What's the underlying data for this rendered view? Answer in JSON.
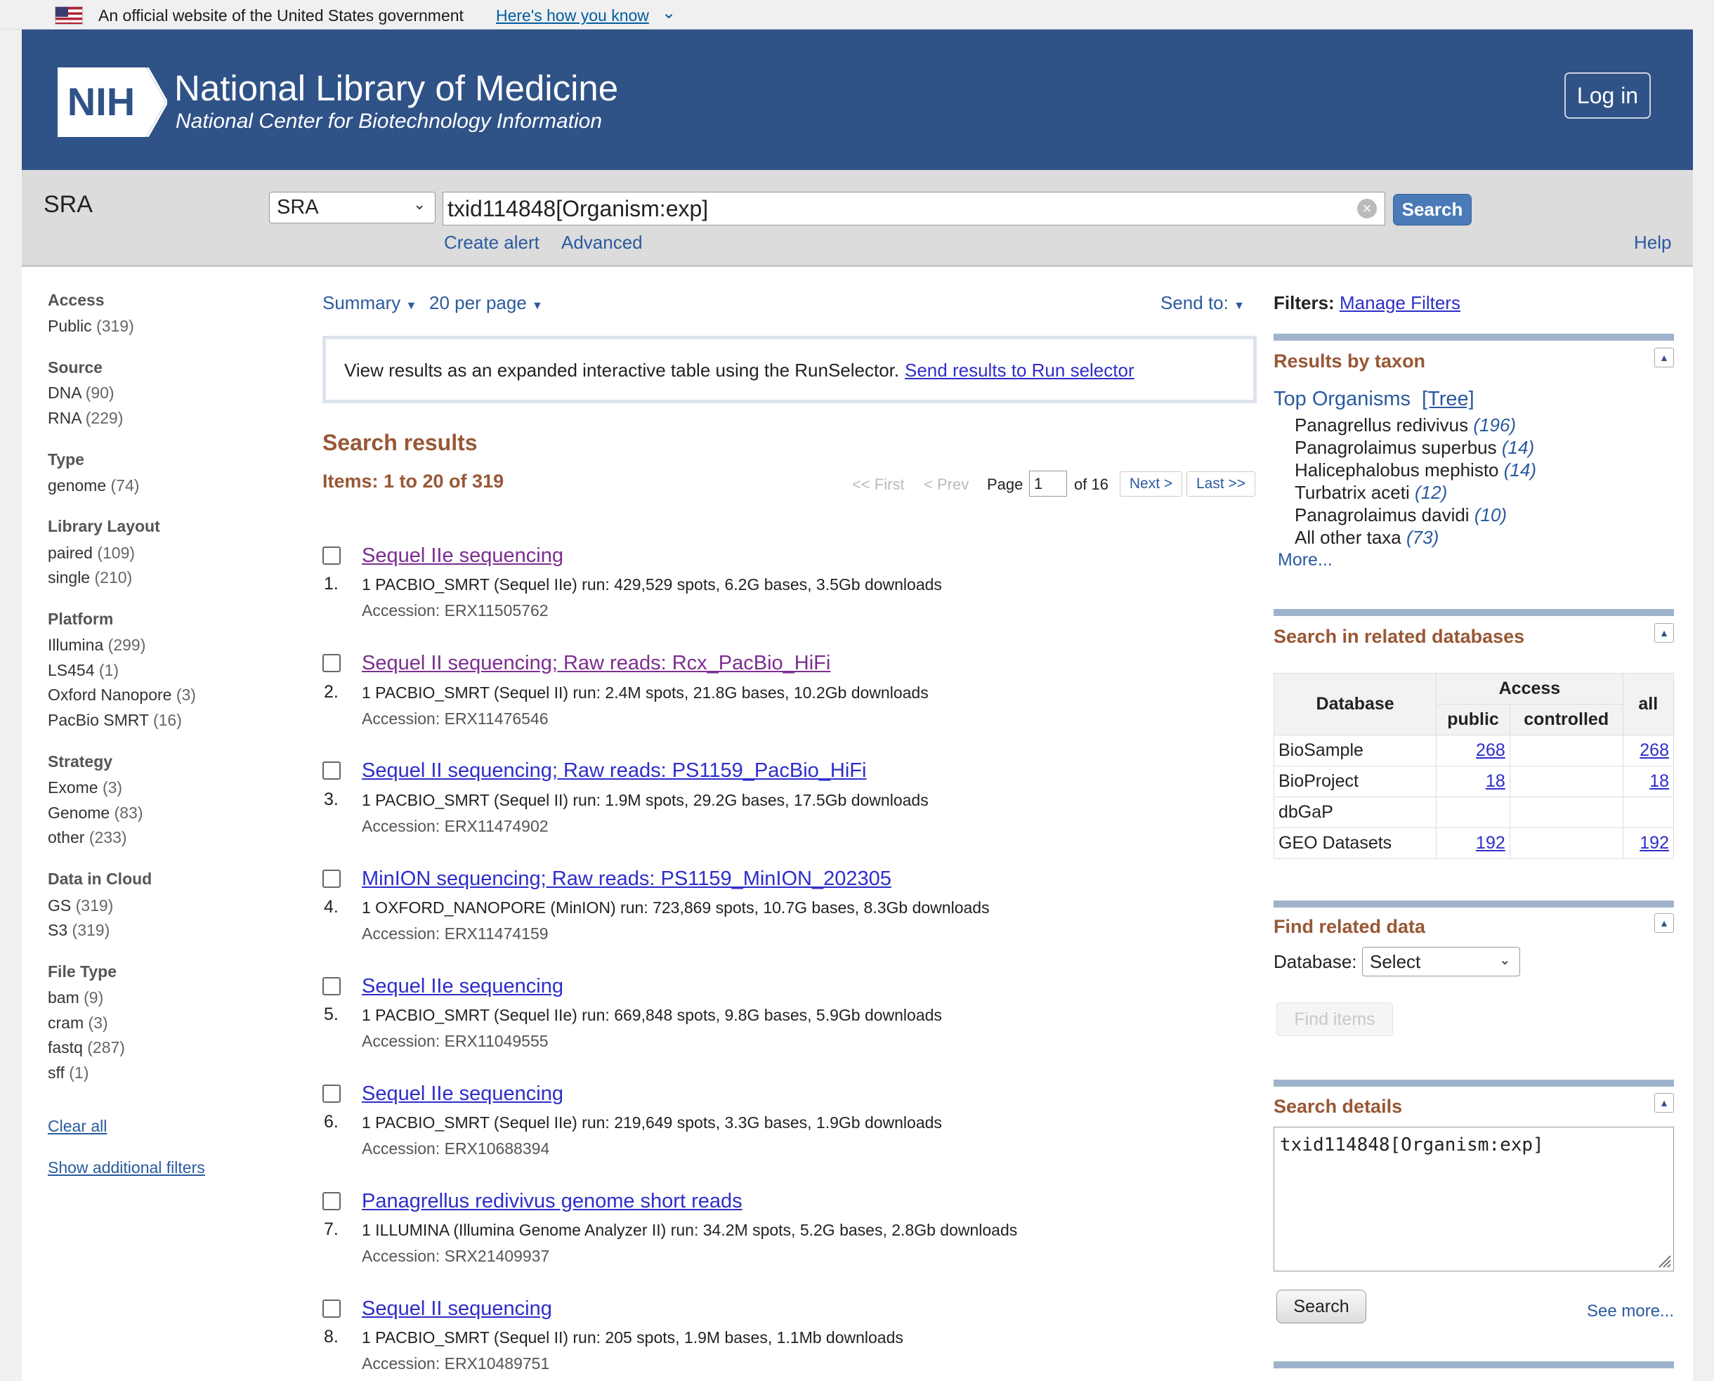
{
  "gov_banner": {
    "text": "An official website of the United States government",
    "link": "Here's how you know"
  },
  "header": {
    "logo_text": "NIH",
    "title": "National Library of Medicine",
    "subtitle": "National Center for Biotechnology Information",
    "login": "Log in"
  },
  "search": {
    "db_name": "SRA",
    "db_select": "SRA",
    "term": "txid114848[Organism:exp]",
    "button": "Search",
    "create_alert": "Create alert",
    "advanced": "Advanced",
    "help": "Help"
  },
  "filters": {
    "groups": [
      {
        "title": "Access",
        "items": [
          {
            "label": "Public",
            "count": "(319)"
          }
        ]
      },
      {
        "title": "Source",
        "items": [
          {
            "label": "DNA",
            "count": "(90)"
          },
          {
            "label": "RNA",
            "count": "(229)"
          }
        ]
      },
      {
        "title": "Type",
        "items": [
          {
            "label": "genome",
            "count": "(74)"
          }
        ]
      },
      {
        "title": "Library Layout",
        "items": [
          {
            "label": "paired",
            "count": "(109)"
          },
          {
            "label": "single",
            "count": "(210)"
          }
        ]
      },
      {
        "title": "Platform",
        "items": [
          {
            "label": "Illumina",
            "count": "(299)"
          },
          {
            "label": "LS454",
            "count": "(1)"
          },
          {
            "label": "Oxford Nanopore",
            "count": "(3)"
          },
          {
            "label": "PacBio SMRT",
            "count": "(16)"
          }
        ]
      },
      {
        "title": "Strategy",
        "items": [
          {
            "label": "Exome",
            "count": "(3)"
          },
          {
            "label": "Genome",
            "count": "(83)"
          },
          {
            "label": "other",
            "count": "(233)"
          }
        ]
      },
      {
        "title": "Data in Cloud",
        "items": [
          {
            "label": "GS",
            "count": "(319)"
          },
          {
            "label": "S3",
            "count": "(319)"
          }
        ]
      },
      {
        "title": "File Type",
        "items": [
          {
            "label": "bam",
            "count": "(9)"
          },
          {
            "label": "cram",
            "count": "(3)"
          },
          {
            "label": "fastq",
            "count": "(287)"
          },
          {
            "label": "sff",
            "count": "(1)"
          }
        ]
      }
    ],
    "clear_all": "Clear all",
    "show_additional": "Show additional filters"
  },
  "controls": {
    "summary": "Summary",
    "per_page": "20 per page",
    "send_to": "Send to:"
  },
  "runselector": {
    "text": "View results as an expanded interactive table using the RunSelector.",
    "link": "Send results to Run selector"
  },
  "results": {
    "title": "Search results",
    "items_count": "Items: 1 to 20 of 319",
    "pager": {
      "first": "<< First",
      "prev": "< Prev",
      "page_label": "Page",
      "page_value": "1",
      "of": "of 16",
      "next": "Next >",
      "last": "Last >>"
    },
    "list": [
      {
        "num": "1.",
        "title": "Sequel IIe sequencing",
        "desc": "1 PACBIO_SMRT (Sequel IIe) run: 429,529 spots, 6.2G bases, 3.5Gb downloads",
        "acc": "Accession: ERX11505762"
      },
      {
        "num": "2.",
        "title": "Sequel II sequencing; Raw reads: Rcx_PacBio_HiFi",
        "desc": "1 PACBIO_SMRT (Sequel II) run: 2.4M spots, 21.8G bases, 10.2Gb downloads",
        "acc": "Accession: ERX11476546"
      },
      {
        "num": "3.",
        "title": "Sequel II sequencing; Raw reads: PS1159_PacBio_HiFi",
        "desc": "1 PACBIO_SMRT (Sequel II) run: 1.9M spots, 29.2G bases, 17.5Gb downloads",
        "acc": "Accession: ERX11474902"
      },
      {
        "num": "4.",
        "title": "MinION sequencing; Raw reads: PS1159_MinION_202305",
        "desc": "1 OXFORD_NANOPORE (MinION) run: 723,869 spots, 10.7G bases, 8.3Gb downloads",
        "acc": "Accession: ERX11474159"
      },
      {
        "num": "5.",
        "title": "Sequel IIe sequencing",
        "desc": "1 PACBIO_SMRT (Sequel IIe) run: 669,848 spots, 9.8G bases, 5.9Gb downloads",
        "acc": "Accession: ERX11049555"
      },
      {
        "num": "6.",
        "title": "Sequel IIe sequencing",
        "desc": "1 PACBIO_SMRT (Sequel IIe) run: 219,649 spots, 3.3G bases, 1.9Gb downloads",
        "acc": "Accession: ERX10688394"
      },
      {
        "num": "7.",
        "title": "Panagrellus redivivus genome short reads",
        "desc": "1 ILLUMINA (Illumina Genome Analyzer II) run: 34.2M spots, 5.2G bases, 2.8Gb downloads",
        "acc": "Accession: SRX21409937"
      },
      {
        "num": "8.",
        "title": "Sequel II sequencing",
        "desc": "1 PACBIO_SMRT (Sequel II) run: 205 spots, 1.9M bases, 1.1Mb downloads",
        "acc": "Accession: ERX10489751"
      }
    ]
  },
  "right": {
    "filters_label": "Filters:",
    "manage_filters": "Manage Filters",
    "taxon": {
      "title": "Results by taxon",
      "top_organisms": "Top Organisms",
      "tree": "[Tree]",
      "organisms": [
        {
          "name": "Panagrellus redivivus",
          "count": "(196)"
        },
        {
          "name": "Panagrolaimus superbus",
          "count": "(14)"
        },
        {
          "name": "Halicephalobus mephisto",
          "count": "(14)"
        },
        {
          "name": "Turbatrix aceti",
          "count": "(12)"
        },
        {
          "name": "Panagrolaimus davidi",
          "count": "(10)"
        },
        {
          "name": "All other taxa",
          "count": "(73)"
        }
      ],
      "more": "More..."
    },
    "related": {
      "title": "Search in related databases",
      "head_database": "Database",
      "head_access": "Access",
      "head_public": "public",
      "head_controlled": "controlled",
      "head_all": "all",
      "rows": [
        {
          "db": "BioSample",
          "public": "268",
          "controlled": "",
          "all": "268"
        },
        {
          "db": "BioProject",
          "public": "18",
          "controlled": "",
          "all": "18"
        },
        {
          "db": "dbGaP",
          "public": "",
          "controlled": "",
          "all": ""
        },
        {
          "db": "GEO Datasets",
          "public": "192",
          "controlled": "",
          "all": "192"
        }
      ]
    },
    "find": {
      "title": "Find related data",
      "db_label": "Database:",
      "select": "Select",
      "button": "Find items"
    },
    "details": {
      "title": "Search details",
      "query": "txid114848[Organism:exp]",
      "button": "Search",
      "see_more": "See more..."
    }
  }
}
